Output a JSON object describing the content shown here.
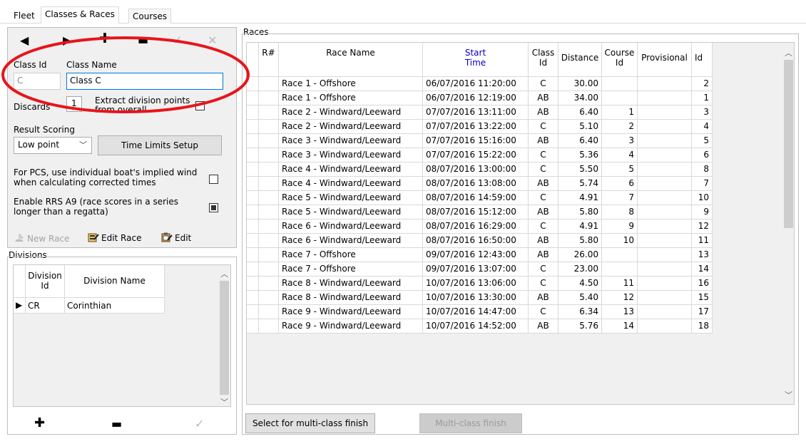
{
  "tabs": [
    {
      "label": "Fleet",
      "active": false
    },
    {
      "label": "Classes & Races",
      "active": true
    },
    {
      "label": "Courses",
      "active": false
    }
  ],
  "class_panel": {
    "class_id_label": "Class Id",
    "class_name_label": "Class Name",
    "class_id_value": "C",
    "class_name_value": "Class C",
    "discards_label": "Discards",
    "discards_value": "1",
    "extract_label": "Extract division points from overall",
    "result_scoring_label": "Result Scoring",
    "result_scoring_value": "Low point",
    "time_limits_button": "Time Limits Setup",
    "pcs_label": "For PCS, use individual boat's implied wind when calculating corrected times",
    "pcs_checked": false,
    "rrs_label": "Enable RRS A9 (race scores in a series longer than a regatta)",
    "rrs_checked": true,
    "new_race_label": "New Race",
    "edit_race_label": "Edit Race",
    "edit_label": "Edit"
  },
  "divisions": {
    "title": "Divisions",
    "headers": {
      "id": "Division Id",
      "name": "Division Name"
    },
    "rows": [
      {
        "id": "CR",
        "name": "Corinthian"
      }
    ]
  },
  "races": {
    "title": "Races",
    "headers": {
      "r": "R#",
      "name": "Race Name",
      "start": "Start Time",
      "class": "Class Id",
      "distance": "Distance",
      "course": "Course Id",
      "provisional": "Provisional",
      "id": "Id"
    },
    "rows": [
      {
        "name": "Race 1 - Offshore",
        "start": "06/07/2016 11:20:00",
        "class": "C",
        "distance": "30.00",
        "course": "",
        "id": "2"
      },
      {
        "name": "Race 1 - Offshore",
        "start": "06/07/2016 12:19:00",
        "class": "AB",
        "distance": "34.00",
        "course": "",
        "id": "1"
      },
      {
        "name": "Race 2 - Windward/Leeward",
        "start": "07/07/2016 13:11:00",
        "class": "AB",
        "distance": "6.40",
        "course": "1",
        "id": "3"
      },
      {
        "name": "Race 2 - Windward/Leeward",
        "start": "07/07/2016 13:22:00",
        "class": "C",
        "distance": "5.10",
        "course": "2",
        "id": "4"
      },
      {
        "name": "Race 3 - Windward/Leeward",
        "start": "07/07/2016 15:16:00",
        "class": "AB",
        "distance": "6.40",
        "course": "3",
        "id": "5"
      },
      {
        "name": "Race 3 - Windward/Leeward",
        "start": "07/07/2016 15:22:00",
        "class": "C",
        "distance": "5.36",
        "course": "4",
        "id": "6"
      },
      {
        "name": "Race 4 - Windward/Leeward",
        "start": "08/07/2016 13:00:00",
        "class": "C",
        "distance": "5.50",
        "course": "5",
        "id": "8"
      },
      {
        "name": "Race 4 - Windward/Leeward",
        "start": "08/07/2016 13:08:00",
        "class": "AB",
        "distance": "5.74",
        "course": "6",
        "id": "7"
      },
      {
        "name": "Race 5 - Windward/Leeward",
        "start": "08/07/2016 14:59:00",
        "class": "C",
        "distance": "4.91",
        "course": "7",
        "id": "10"
      },
      {
        "name": "Race 5 - Windward/Leeward",
        "start": "08/07/2016 15:12:00",
        "class": "AB",
        "distance": "5.80",
        "course": "8",
        "id": "9"
      },
      {
        "name": "Race 6 - Windward/Leeward",
        "start": "08/07/2016 16:29:00",
        "class": "C",
        "distance": "4.91",
        "course": "9",
        "id": "12"
      },
      {
        "name": "Race 6 - Windward/Leeward",
        "start": "08/07/2016 16:50:00",
        "class": "AB",
        "distance": "5.80",
        "course": "10",
        "id": "11"
      },
      {
        "name": "Race 7 - Offshore",
        "start": "09/07/2016 12:43:00",
        "class": "AB",
        "distance": "26.00",
        "course": "",
        "id": "13"
      },
      {
        "name": "Race 7 - Offshore",
        "start": "09/07/2016 13:07:00",
        "class": "C",
        "distance": "23.00",
        "course": "",
        "id": "14"
      },
      {
        "name": "Race 8 - Windward/Leeward",
        "start": "10/07/2016 13:06:00",
        "class": "C",
        "distance": "4.50",
        "course": "11",
        "id": "16"
      },
      {
        "name": "Race 8 - Windward/Leeward",
        "start": "10/07/2016 13:30:00",
        "class": "AB",
        "distance": "5.40",
        "course": "12",
        "id": "15"
      },
      {
        "name": "Race 9 - Windward/Leeward",
        "start": "10/07/2016 14:47:00",
        "class": "C",
        "distance": "6.34",
        "course": "13",
        "id": "17"
      },
      {
        "name": "Race 9 - Windward/Leeward",
        "start": "10/07/2016 14:52:00",
        "class": "AB",
        "distance": "5.76",
        "course": "14",
        "id": "18"
      }
    ],
    "multi_select_button": "Select for multi-class finish",
    "multi_finish_button": "Multi-class finish"
  },
  "colors": {
    "annotation": "#e8141b",
    "header_accent": "#0000cc"
  }
}
